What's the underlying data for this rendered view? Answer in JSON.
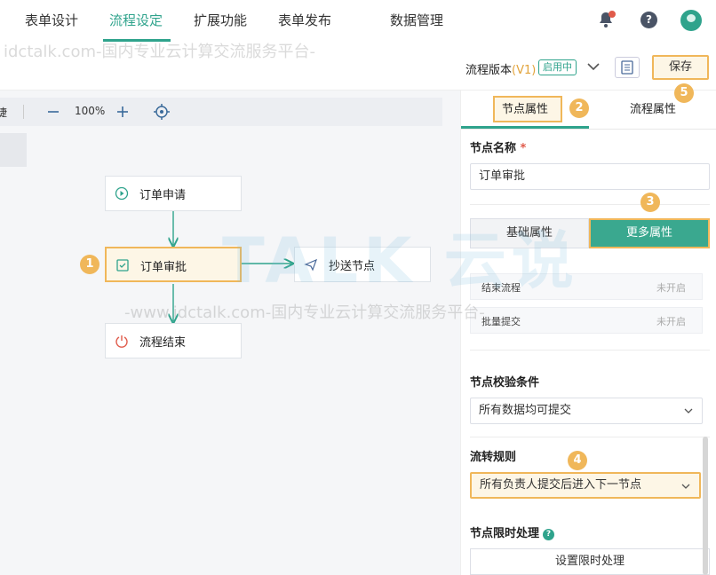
{
  "nav": {
    "tabs": [
      "表单设计",
      "流程设定",
      "扩展功能",
      "表单发布",
      "数据管理"
    ],
    "active_tab": "流程设定"
  },
  "subbar": {
    "version_label": "流程版本",
    "version": "(V1)",
    "status_badge": "启用中",
    "save_label": "保存"
  },
  "toolbar": {
    "partial_left": "捷",
    "zoom": "100%"
  },
  "flow": {
    "nodes": [
      {
        "label": "订单申请",
        "icon": "play-circle-icon"
      },
      {
        "label": "订单审批",
        "icon": "approve-icon"
      },
      {
        "label": "抄送节点",
        "icon": "send-icon"
      },
      {
        "label": "流程结束",
        "icon": "power-icon"
      }
    ]
  },
  "panel": {
    "tabs": [
      "节点属性",
      "流程属性"
    ],
    "node_name_label": "节点名称",
    "required_mark": "*",
    "node_name_value": "订单审批",
    "seg_basic": "基础属性",
    "seg_more": "更多属性",
    "switches": [
      {
        "key": "结束流程",
        "value": "未开启"
      },
      {
        "key": "批量提交",
        "value": "未开启"
      }
    ],
    "check_label": "节点校验条件",
    "check_value": "所有数据均可提交",
    "rule_label": "流转规则",
    "rule_value": "所有负责人提交后进入下一节点",
    "timeout_label": "节点限时处理",
    "timeout_button": "设置限时处理"
  },
  "annotations": [
    "1",
    "2",
    "3",
    "4",
    "5"
  ],
  "watermarks": {
    "line1": "idctalk.com-国内专业云计算交流服务平台-",
    "line2": "-www.idctalk.com-国内专业云计算交流服务平台-",
    "brand": "TALK 云说"
  },
  "colors": {
    "accent": "#2fa38c",
    "highlight": "#f0b75a"
  }
}
